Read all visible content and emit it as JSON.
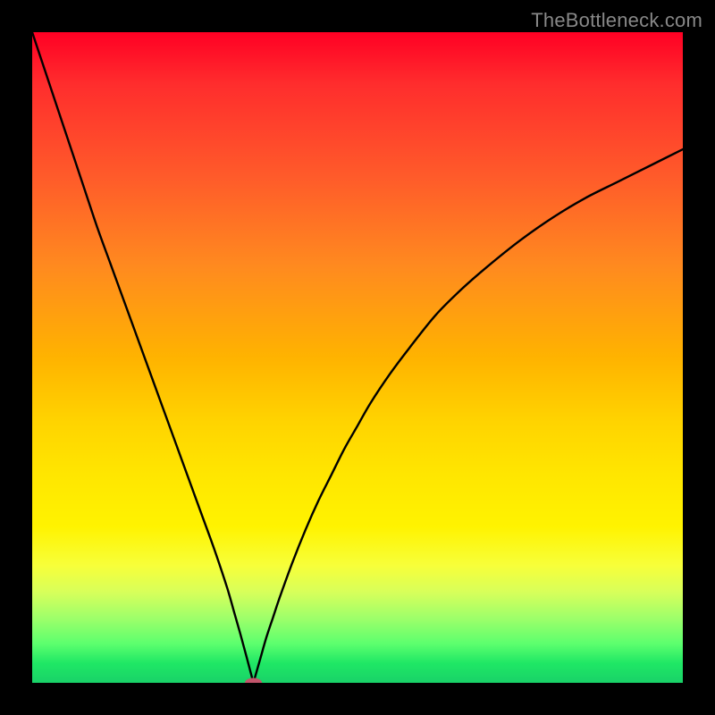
{
  "watermark": "TheBottleneck.com",
  "colors": {
    "frame": "#000000",
    "gradient_top": "#ff0024",
    "gradient_bottom": "#19d268",
    "curve": "#000000",
    "marker": "#c2556b",
    "watermark_text": "#888888"
  },
  "chart_data": {
    "type": "line",
    "title": "",
    "xlabel": "",
    "ylabel": "",
    "xlim": [
      0,
      100
    ],
    "ylim": [
      0,
      100
    ],
    "grid": false,
    "legend": false,
    "annotations": [
      {
        "type": "marker",
        "x": 34,
        "y": 0,
        "shape": "oval",
        "color": "#c2556b"
      }
    ],
    "series": [
      {
        "name": "bottleneck-curve-left",
        "x": [
          0,
          2,
          4,
          6,
          8,
          10,
          12,
          14,
          16,
          18,
          20,
          22,
          24,
          26,
          28,
          30,
          31,
          32,
          33,
          34
        ],
        "values": [
          100,
          94,
          88,
          82,
          76,
          70,
          64.5,
          59,
          53.5,
          48,
          42.5,
          37,
          31.5,
          26,
          20.5,
          14.5,
          11,
          7.5,
          3.8,
          0
        ]
      },
      {
        "name": "bottleneck-curve-right",
        "x": [
          34,
          35,
          36,
          37,
          38,
          40,
          42,
          44,
          46,
          48,
          50,
          52,
          55,
          58,
          62,
          66,
          70,
          75,
          80,
          85,
          90,
          95,
          100
        ],
        "values": [
          0,
          3.5,
          7,
          10,
          13,
          18.5,
          23.5,
          28,
          32,
          36,
          39.5,
          43,
          47.5,
          51.5,
          56.5,
          60.5,
          64,
          68,
          71.5,
          74.5,
          77,
          79.5,
          82
        ]
      }
    ]
  }
}
